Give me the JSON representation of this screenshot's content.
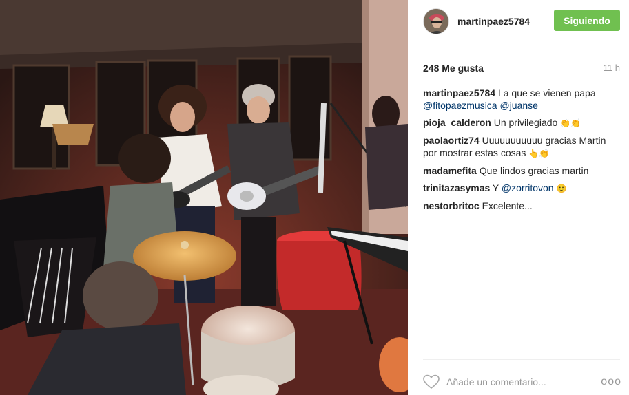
{
  "post": {
    "username": "martinpaez5784",
    "follow_label": "Siguiendo",
    "likes": "248 Me gusta",
    "time": "11 h"
  },
  "comments": [
    {
      "user": "martinpaez5784",
      "parts": [
        {
          "t": "La que se vienen papa "
        },
        {
          "m": "@fitopaezmusica"
        },
        {
          "t": " "
        },
        {
          "m": "@juanse"
        }
      ]
    },
    {
      "user": "pioja_calderon",
      "parts": [
        {
          "t": "Un privilegiado "
        }
      ],
      "emoji": "👏👏"
    },
    {
      "user": "paolaortiz74",
      "parts": [
        {
          "t": "Uuuuuuuuuuu gracias Martin por mostrar estas cosas "
        }
      ],
      "emoji": "👆👏"
    },
    {
      "user": "madamefita",
      "parts": [
        {
          "t": "Que lindos gracias martin"
        }
      ]
    },
    {
      "user": "trinitazasymas",
      "parts": [
        {
          "t": "Y "
        },
        {
          "m": "@zorritovon"
        },
        {
          "t": " "
        }
      ],
      "emoji": "🙂"
    },
    {
      "user": "nestorbritoc",
      "parts": [
        {
          "t": "Excelente..."
        }
      ]
    }
  ],
  "footer": {
    "comment_placeholder": "Añade un comentario...",
    "more_label": "ooo"
  },
  "colors": {
    "follow_button": "#70c050",
    "mention": "#003569",
    "muted": "#999999"
  },
  "icons": [
    "heart-icon",
    "more-options-icon"
  ]
}
